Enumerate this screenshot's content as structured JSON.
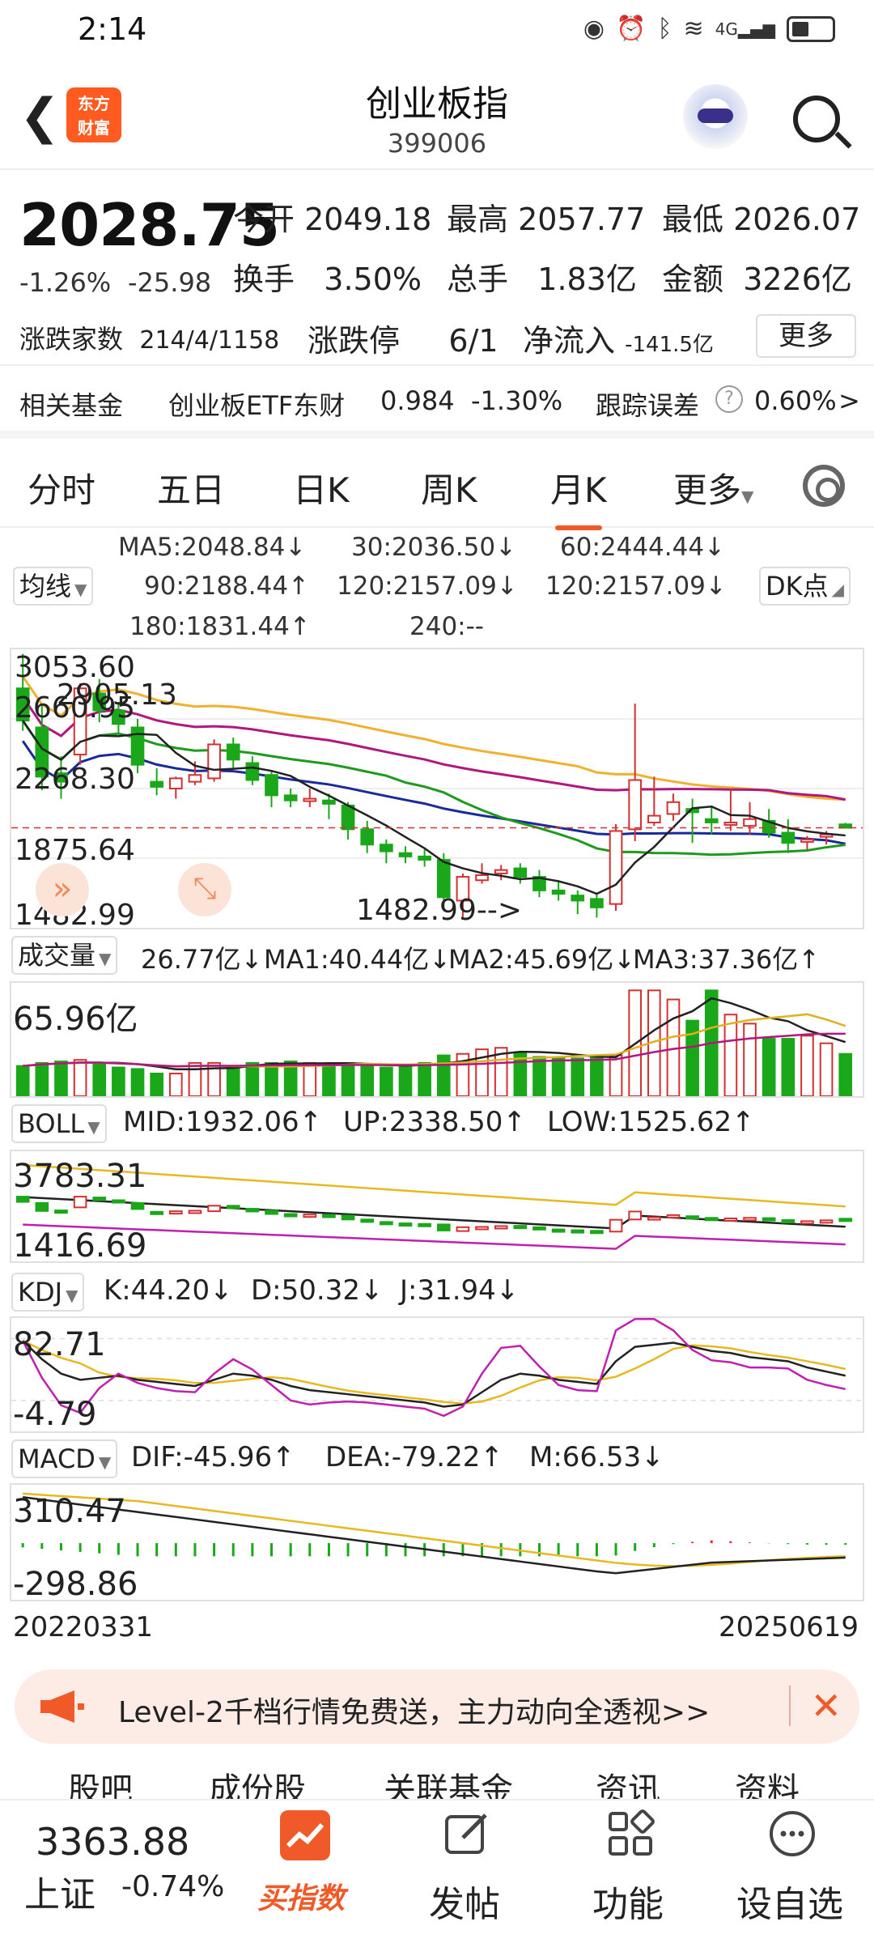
{
  "status": {
    "time": "2:14",
    "icons": [
      "eye-icon",
      "alarm-icon",
      "bluetooth-icon",
      "wifi-icon",
      "4g-signal-icon",
      "battery-icon"
    ],
    "net": "4G"
  },
  "header": {
    "title": "创业板指",
    "code": "399006",
    "back_icon": "chevron-left-icon",
    "logo_text": "东方\n财富",
    "logo_line1": "东方",
    "logo_line2": "财富"
  },
  "quote": {
    "price": "2028.75",
    "pct": "-1.26%",
    "change": "-25.98",
    "open_label": "今开",
    "open": "2049.18",
    "high_label": "最高",
    "high": "2057.77",
    "low_label": "最低",
    "low": "2026.07",
    "turnover_label": "换手",
    "turnover": "3.50%",
    "volume_label": "总手",
    "volume": "1.83亿",
    "amount_label": "金额",
    "amount": "3226亿",
    "breadth_label": "涨跌家数",
    "breadth": "214/4/1158",
    "limit_label": "涨跌停",
    "limit": "6/1",
    "netflow_label": "净流入",
    "netflow": "-141.5亿",
    "more_label": "更多"
  },
  "fund": {
    "label": "相关基金",
    "name": "创业板ETF东财",
    "price": "0.984",
    "pct": "-1.30%",
    "track_label": "跟踪误差",
    "track": "0.60%",
    "arrow": ">"
  },
  "tabs": [
    "分时",
    "五日",
    "日K",
    "周K",
    "月K",
    "更多"
  ],
  "active_tab": "月K",
  "ma": {
    "selector": "均线",
    "ma5": "MA5:2048.84↓",
    "ma30": "30:2036.50↓",
    "ma60": "60:2444.44↓",
    "ma90": "90:2188.44↑",
    "ma120a": "120:2157.09↓",
    "ma120b": "120:2157.09↓",
    "ma180": "180:1831.44↑",
    "ma240": "240:--",
    "dk": "DK点"
  },
  "kline": {
    "y1": "3053.60",
    "y2": "2905.13",
    "y3": "2660.95",
    "y4": "2268.30",
    "y5": "1875.64",
    "y6": "1482.99",
    "min_marker": "1482.99-->"
  },
  "volume": {
    "selector": "成交量",
    "v": "26.77亿↓",
    "ma1": "MA1:40.44亿↓",
    "ma2": "MA2:45.69亿↓",
    "ma3": "MA3:37.36亿↑",
    "top": "65.96亿"
  },
  "boll": {
    "selector": "BOLL",
    "mid": "MID:1932.06↑",
    "up": "UP:2338.50↑",
    "low": "LOW:1525.62↑",
    "top": "3783.31",
    "bottom": "1416.69"
  },
  "kdj": {
    "selector": "KDJ",
    "k": "K:44.20↓",
    "d": "D:50.32↓",
    "j": "J:31.94↓",
    "top": "82.71",
    "bottom": "-4.79"
  },
  "macd": {
    "selector": "MACD",
    "dif": "DIF:-45.96↑",
    "dea": "DEA:-79.22↑",
    "m": "M:66.53↓",
    "top": "310.47",
    "bottom": "-298.86"
  },
  "dates": {
    "start": "20220331",
    "end": "20250619"
  },
  "banner": {
    "text": "Level-2千档行情免费送，主力动向全透视>>",
    "close": "✕"
  },
  "subtabs": [
    "股吧",
    "成份股",
    "关联基金",
    "资讯",
    "资料"
  ],
  "footer": {
    "index_value": "3363.88",
    "index_name": "上证",
    "index_pct": "-0.74%",
    "buy_label": "买指数",
    "post_label": "发帖",
    "func_label": "功能",
    "fav_label": "设自选"
  },
  "colors": {
    "up": "#d43030",
    "down": "#1aa81a",
    "accent": "#f05a28",
    "ma5": "#222222",
    "ma30": "#1e9a1e",
    "ma60": "#f0b030",
    "ma90": "#b01880",
    "ma120": "#1a2a9a"
  },
  "chart_data": {
    "type": "candlestick",
    "candles": [
      {
        "o": 2850,
        "h": 3053,
        "c": 2660,
        "l": 2600
      },
      {
        "o": 2620,
        "h": 2750,
        "c": 2330,
        "l": 2250
      },
      {
        "o": 2350,
        "h": 2450,
        "c": 2300,
        "l": 2200
      },
      {
        "o": 2460,
        "h": 2880,
        "c": 2850,
        "l": 2400
      },
      {
        "o": 2820,
        "h": 2905,
        "c": 2720,
        "l": 2650
      },
      {
        "o": 2720,
        "h": 2770,
        "c": 2640,
        "l": 2580
      },
      {
        "o": 2620,
        "h": 2670,
        "c": 2400,
        "l": 2350
      },
      {
        "o": 2300,
        "h": 2380,
        "c": 2270,
        "l": 2220
      },
      {
        "o": 2260,
        "h": 2330,
        "c": 2320,
        "l": 2200
      },
      {
        "o": 2300,
        "h": 2420,
        "c": 2340,
        "l": 2280
      },
      {
        "o": 2320,
        "h": 2550,
        "c": 2520,
        "l": 2300
      },
      {
        "o": 2520,
        "h": 2560,
        "c": 2430,
        "l": 2380
      },
      {
        "o": 2410,
        "h": 2450,
        "c": 2310,
        "l": 2280
      },
      {
        "o": 2340,
        "h": 2360,
        "c": 2220,
        "l": 2150
      },
      {
        "o": 2220,
        "h": 2260,
        "c": 2190,
        "l": 2150
      },
      {
        "o": 2200,
        "h": 2260,
        "c": 2200,
        "l": 2150
      },
      {
        "o": 2190,
        "h": 2230,
        "c": 2170,
        "l": 2080
      },
      {
        "o": 2160,
        "h": 2180,
        "c": 2020,
        "l": 1960
      },
      {
        "o": 2020,
        "h": 2070,
        "c": 1930,
        "l": 1880
      },
      {
        "o": 1930,
        "h": 1960,
        "c": 1890,
        "l": 1820
      },
      {
        "o": 1880,
        "h": 1920,
        "c": 1860,
        "l": 1820
      },
      {
        "o": 1860,
        "h": 1900,
        "c": 1840,
        "l": 1800
      },
      {
        "o": 1840,
        "h": 1880,
        "c": 1620,
        "l": 1560
      },
      {
        "o": 1600,
        "h": 1760,
        "c": 1740,
        "l": 1490
      },
      {
        "o": 1720,
        "h": 1820,
        "c": 1750,
        "l": 1700
      },
      {
        "o": 1760,
        "h": 1810,
        "c": 1780,
        "l": 1720
      },
      {
        "o": 1790,
        "h": 1820,
        "c": 1740,
        "l": 1700
      },
      {
        "o": 1740,
        "h": 1780,
        "c": 1660,
        "l": 1620
      },
      {
        "o": 1660,
        "h": 1720,
        "c": 1640,
        "l": 1600
      },
      {
        "o": 1630,
        "h": 1660,
        "c": 1600,
        "l": 1520
      },
      {
        "o": 1610,
        "h": 1640,
        "c": 1560,
        "l": 1500
      },
      {
        "o": 1580,
        "h": 2050,
        "c": 2010,
        "l": 1540
      },
      {
        "o": 2020,
        "h": 2760,
        "c": 2310,
        "l": 1950
      },
      {
        "o": 2060,
        "h": 2330,
        "c": 2100,
        "l": 2040
      },
      {
        "o": 2110,
        "h": 2230,
        "c": 2180,
        "l": 2070
      },
      {
        "o": 2140,
        "h": 2200,
        "c": 2120,
        "l": 1940
      },
      {
        "o": 2080,
        "h": 2160,
        "c": 2060,
        "l": 1990
      },
      {
        "o": 2050,
        "h": 2260,
        "c": 2060,
        "l": 2010
      },
      {
        "o": 2040,
        "h": 2180,
        "c": 2080,
        "l": 1990
      },
      {
        "o": 2070,
        "h": 2140,
        "c": 2000,
        "l": 1970
      },
      {
        "o": 2000,
        "h": 2080,
        "c": 1940,
        "l": 1880
      },
      {
        "o": 1950,
        "h": 1980,
        "c": 1960,
        "l": 1900
      },
      {
        "o": 1980,
        "h": 2010,
        "c": 1990,
        "l": 1930
      },
      {
        "o": 2049,
        "h": 2058,
        "c": 2029,
        "l": 2026
      }
    ]
  }
}
